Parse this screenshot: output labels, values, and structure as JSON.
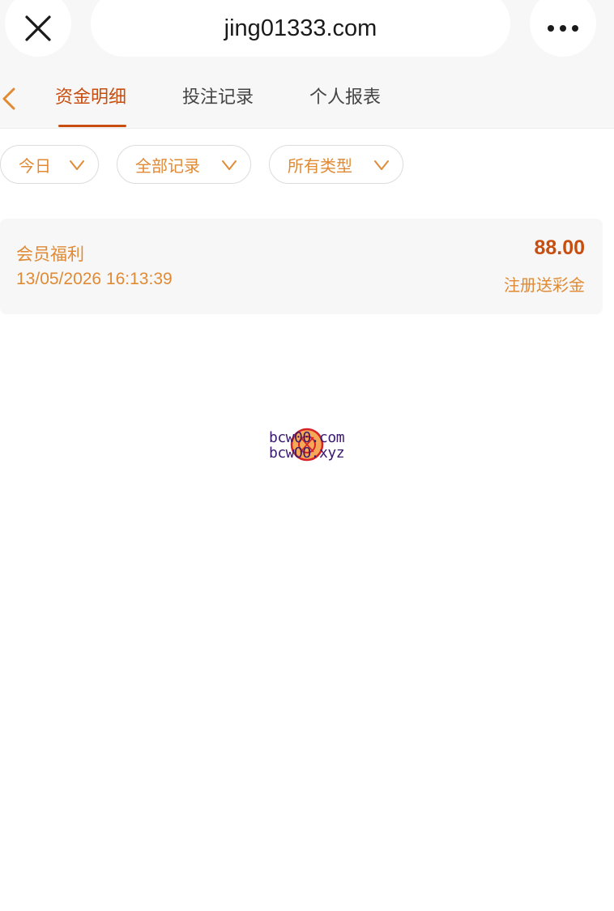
{
  "browser": {
    "url": "jing01333.com",
    "close_icon": "close-icon",
    "more_icon": "more-icon"
  },
  "tabs": [
    {
      "label": "资金明细",
      "active": true
    },
    {
      "label": "投注记录",
      "active": false
    },
    {
      "label": "个人报表",
      "active": false
    }
  ],
  "filters": [
    {
      "label": "今日"
    },
    {
      "label": "全部记录"
    },
    {
      "label": "所有类型"
    }
  ],
  "records": [
    {
      "title": "会员福利",
      "time": "13/05/2026 16:13:39",
      "amount": "88.00",
      "description": "注册送彩金"
    }
  ],
  "watermark": {
    "line1": "bcw00.com",
    "line2": "bcwOO.xyz"
  },
  "colors": {
    "accent": "#c84e10",
    "accent_light": "#e08a34",
    "watermark_text": "#3a1a6e"
  }
}
